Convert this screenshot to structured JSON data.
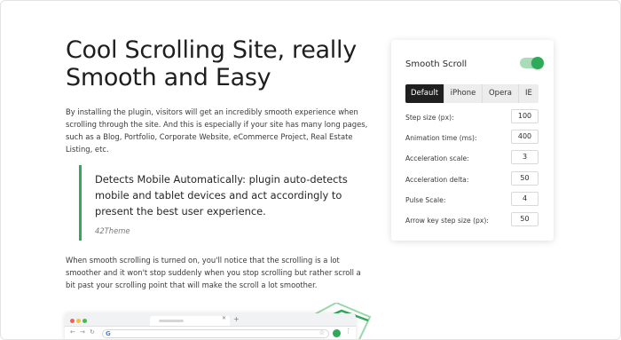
{
  "article": {
    "title": "Cool Scrolling Site, really Smooth and Easy",
    "intro": "By installing the plugin, visitors will get an incredibly smooth experience when scrolling through the site. And this is especially if your site has many long pages, such as a Blog, Portfolio, Corporate Website, eCommerce Project, Real Estate Listing, etc.",
    "quote": {
      "text": "Detects Mobile Automatically: plugin auto-detects mobile and tablet devices and act accordingly to present the best user experience.",
      "author": "42Theme"
    },
    "body": "When smooth scrolling is turned on, you'll notice that the scrolling is a lot smoother and it won't stop suddenly when you stop scrolling but rather scroll a bit past your scrolling point that will make the scroll a lot smoother."
  },
  "settings": {
    "title": "Smooth Scroll",
    "enabled": true,
    "tabs": [
      {
        "label": "Default",
        "active": true
      },
      {
        "label": "iPhone",
        "active": false
      },
      {
        "label": "Opera",
        "active": false
      },
      {
        "label": "IE",
        "active": false
      }
    ],
    "fields": [
      {
        "label": "Step size (px):",
        "value": "100"
      },
      {
        "label": "Animation time (ms):",
        "value": "400"
      },
      {
        "label": "Acceleration scale:",
        "value": "3"
      },
      {
        "label": "Acceleration delta:",
        "value": "50"
      },
      {
        "label": "Pulse Scale:",
        "value": "4"
      },
      {
        "label": "Arrow key step size (px):",
        "value": "50"
      }
    ]
  },
  "icons": {
    "quote_mark": "quote-icon",
    "toggle": "toggle-switch",
    "browser_google": "google-icon"
  },
  "colors": {
    "accent": "#2eaa5a",
    "toggle_track": "#a9dcb8",
    "active_tab": "#1f1f1f",
    "text": "#2b2b2b"
  }
}
